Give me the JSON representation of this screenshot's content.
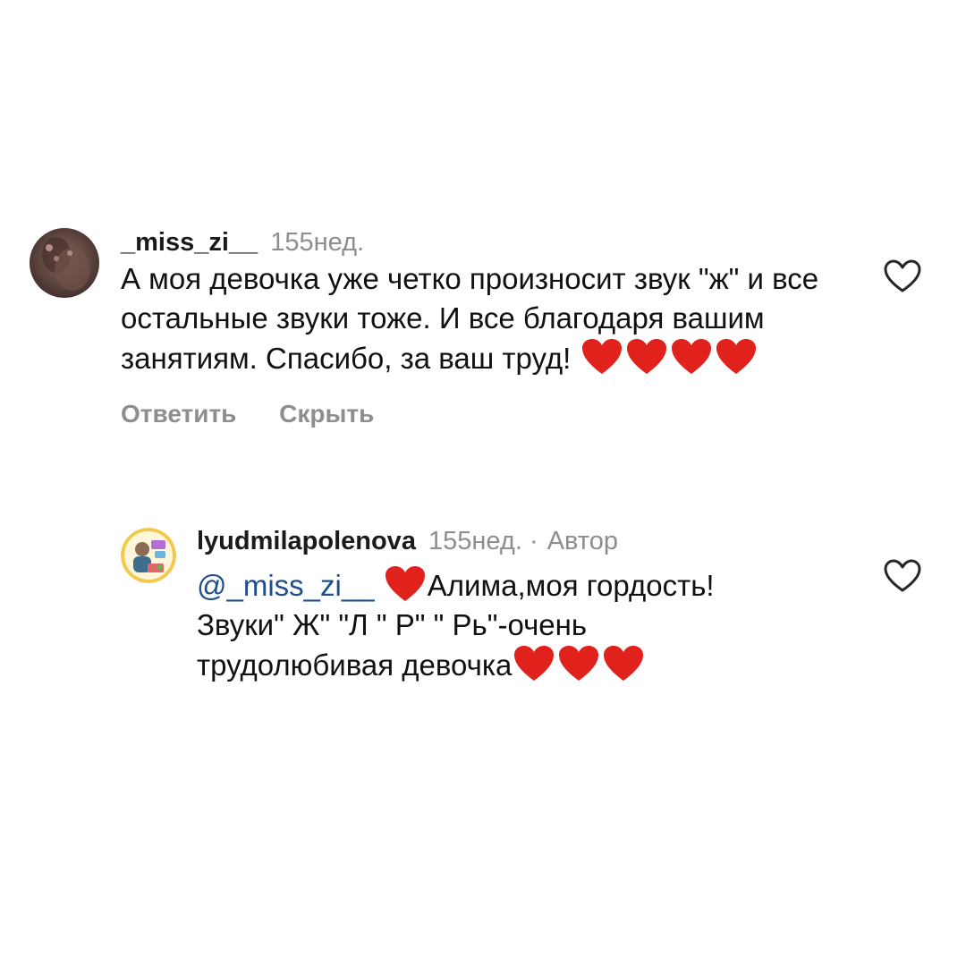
{
  "comments": [
    {
      "username": "_miss_zi__",
      "time": "155нед.",
      "text": "А моя девочка уже четко произносит звук \"ж\" и все остальные звуки тоже. И все благодаря вашим занятиям. Спасибо, за ваш труд!",
      "actions": {
        "reply": "Ответить",
        "hide": "Скрыть"
      },
      "like_icon": "heart-outline-icon"
    },
    {
      "username": "lyudmilapolenova",
      "time": "155нед.",
      "separator": "·",
      "badge": "Автор",
      "mention": "@_miss_zi__",
      "text_line1": "Алима,моя гордость!",
      "text_line2": "Звуки\" Ж\" \"Л \" Р\" \" Рь\"-очень",
      "text_line3": "трудолюбивая девочка",
      "like_icon": "heart-outline-icon"
    }
  ],
  "colors": {
    "meta": "#8e8e8e",
    "mention": "#1f4e8c",
    "heart": "#e0211c"
  }
}
